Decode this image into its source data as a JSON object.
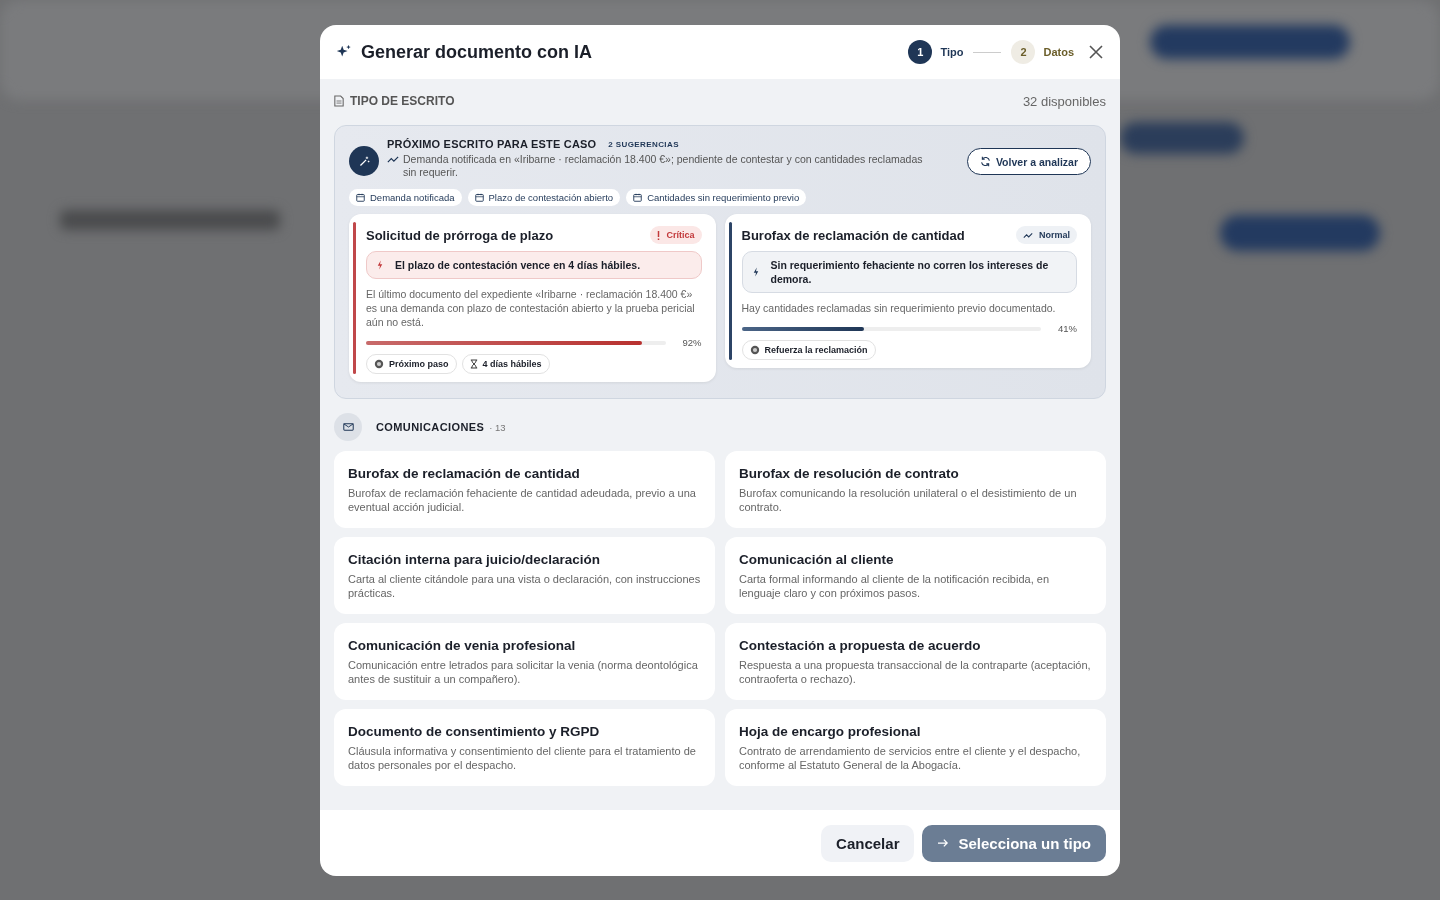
{
  "dialog": {
    "title": "Generar documento con IA",
    "steps": [
      {
        "number": "1",
        "label": "Tipo",
        "selected": true
      },
      {
        "number": "2",
        "label": "Datos",
        "selected": false
      }
    ]
  },
  "section": {
    "title": "TIPO DE ESCRITO",
    "count": "32 disponibles"
  },
  "suggestions": {
    "title": "PRÓXIMO ESCRITO PARA ESTE CASO",
    "badge": "2 SUGERENCIAS",
    "summary": "Demanda notificada en «Iribarne · reclamación 18.400 €»; pendiente de contestar y con cantidades reclamadas sin requerir.",
    "reanalyze_button": "Volver a analizar",
    "tags": [
      "Demanda notificada",
      "Plazo de contestación abierto",
      "Cantidades sin requerimiento previo"
    ],
    "cards": [
      {
        "title": "Solicitud de prórroga de plazo",
        "priority": "Crítica",
        "kind": "critical",
        "alert": "El plazo de contestación vence en 4 días hábiles.",
        "description": "El último documento del expediente «Iribarne · reclamación 18.400 €» es una demanda con plazo de contestación abierto y la prueba pericial aún no está.",
        "level": 0.92,
        "reading": "92%",
        "chips": [
          {
            "kind": "step",
            "label": "Próximo paso"
          },
          {
            "kind": "time",
            "label": "4 días hábiles"
          }
        ]
      },
      {
        "title": "Burofax de reclamación de cantidad",
        "priority": "Normal",
        "kind": "normal",
        "alert": "Sin requerimiento fehaciente no corren los intereses de demora.",
        "description": "Hay cantidades reclamadas sin requerimiento previo documentado.",
        "level": 0.41,
        "reading": "41%",
        "chips": [
          {
            "kind": "step",
            "label": "Refuerza la reclamación"
          }
        ]
      }
    ]
  },
  "category": {
    "name": "COMUNICACIONES",
    "count": "· 13",
    "templates": [
      {
        "title": "Burofax de reclamación de cantidad",
        "description": "Burofax de reclamación fehaciente de cantidad adeudada, previo a una eventual acción judicial."
      },
      {
        "title": "Burofax de resolución de contrato",
        "description": "Burofax comunicando la resolución unilateral o el desistimiento de un contrato."
      },
      {
        "title": "Citación interna para juicio/declaración",
        "description": "Carta al cliente citándole para una vista o declaración, con instrucciones prácticas."
      },
      {
        "title": "Comunicación al cliente",
        "description": "Carta formal informando al cliente de la notificación recibida, en lenguaje claro y con próximos pasos."
      },
      {
        "title": "Comunicación de venia profesional",
        "description": "Comunicación entre letrados para solicitar la venia (norma deontológica antes de sustituir a un compañero)."
      },
      {
        "title": "Contestación a propuesta de acuerdo",
        "description": "Respuesta a una propuesta transaccional de la contraparte (aceptación, contraoferta o rechazo)."
      },
      {
        "title": "Documento de consentimiento y RGPD",
        "description": "Cláusula informativa y consentimiento del cliente para el tratamiento de datos personales por el despacho."
      },
      {
        "title": "Hoja de encargo profesional",
        "description": "Contrato de arrendamiento de servicios entre el cliente y el despacho, conforme al Estatuto General de la Abogacía."
      }
    ]
  },
  "footer": {
    "cancel": "Cancelar",
    "confirm": {
      "label": "Selecciona un tipo",
      "disabled": true
    }
  }
}
